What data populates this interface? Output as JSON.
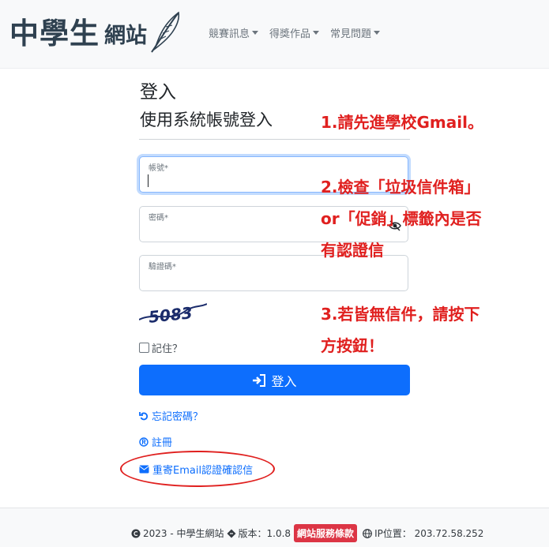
{
  "navbar": {
    "logo_main": "中學生",
    "logo_sub": "網站",
    "menus": [
      {
        "label": "競賽訊息"
      },
      {
        "label": "得獎作品"
      },
      {
        "label": "常見問題"
      }
    ]
  },
  "login": {
    "title": "登入",
    "subtitle": "使用系統帳號登入",
    "account_label": "帳號*",
    "password_label": "密碼*",
    "captcha_label": "驗證碼*",
    "captcha_text": "5083",
    "remember_label": "記住？",
    "submit_label": "登入",
    "forgot_label": "忘記密碼？",
    "register_label": "註冊",
    "resend_label": "重寄Email認證確認信"
  },
  "annotations": {
    "step1": "1.請先進學校Gmail。",
    "step2_line1": "2.檢查「垃圾信件箱」",
    "step2_line2": "or「促銷」標籤內是否",
    "step2_line3": "有認證信",
    "step3_line1": "3.若皆無信件，請按下",
    "step3_line2": "方按鈕！"
  },
  "footer": {
    "copyright": "2023 - 中學生網站",
    "version": "版本：1.0.8",
    "terms_badge": "網站服務條款",
    "ip": "IP位置： 203.72.58.252"
  },
  "colors": {
    "primary": "#0d6efd",
    "annotation_red": "#e0201f",
    "badge_red": "#dc3545"
  }
}
